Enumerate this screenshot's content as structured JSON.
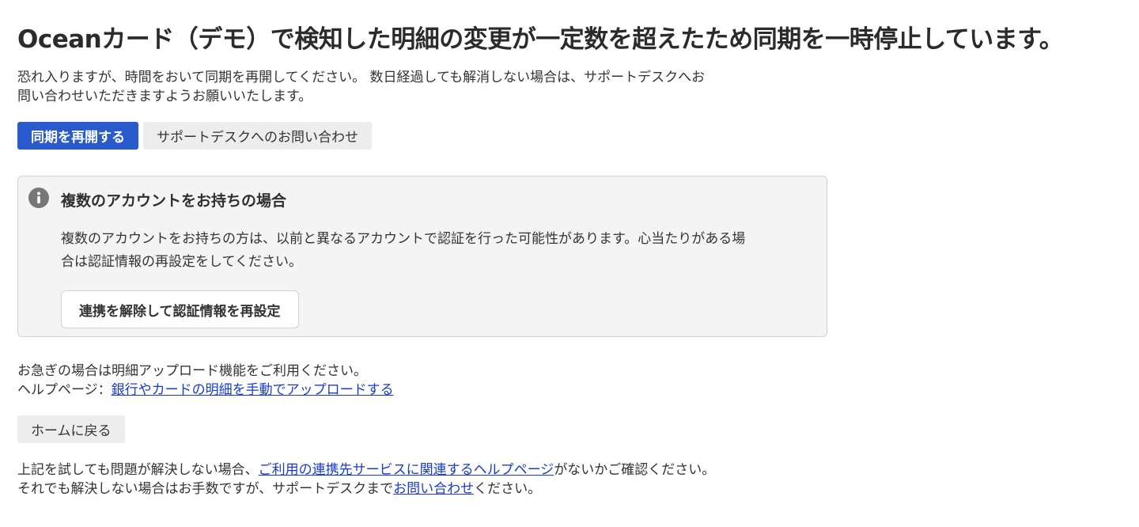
{
  "page": {
    "title": "Oceanカード（デモ）で検知した明細の変更が一定数を超えたため同期を一時停止しています。",
    "lead_line1": "恐れ入りますが、時間をおいて同期を再開してください。 数日経過しても解消しない場合は、サポートデスクへお",
    "lead_line2": "問い合わせいただきますようお願いいたします。"
  },
  "actions": {
    "resume_label": "同期を再開する",
    "support_label": "サポートデスクへのお問い合わせ"
  },
  "callout": {
    "icon": "info-icon",
    "title": "複数のアカウントをお持ちの場合",
    "body_line1": "複数のアカウントをお持ちの方は、以前と異なるアカウントで認証を行った可能性があります。心当たりがある場",
    "body_line2": "合は認証情報の再設定をしてください。",
    "button_label": "連携を解除して認証情報を再設定"
  },
  "urgent": {
    "line1": "お急ぎの場合は明細アップロード機能をご利用ください。",
    "help_prefix": "ヘルプページ：",
    "help_link": "銀行やカードの明細を手動でアップロードする"
  },
  "home": {
    "label": "ホームに戻る"
  },
  "footer": {
    "line1_prefix": "上記を試しても問題が解決しない場合、",
    "line1_link": "ご利用の連携先サービスに関連するヘルプページ",
    "line1_suffix": "がないかご確認ください。",
    "line2_prefix": "それでも解決しない場合はお手数ですが、サポートデスクまで",
    "line2_link": "お問い合わせ",
    "line2_suffix": "ください。"
  },
  "colors": {
    "primary": "#2a5bcc",
    "link": "#1a3cc8",
    "callout_bg": "#f5f4f4"
  }
}
